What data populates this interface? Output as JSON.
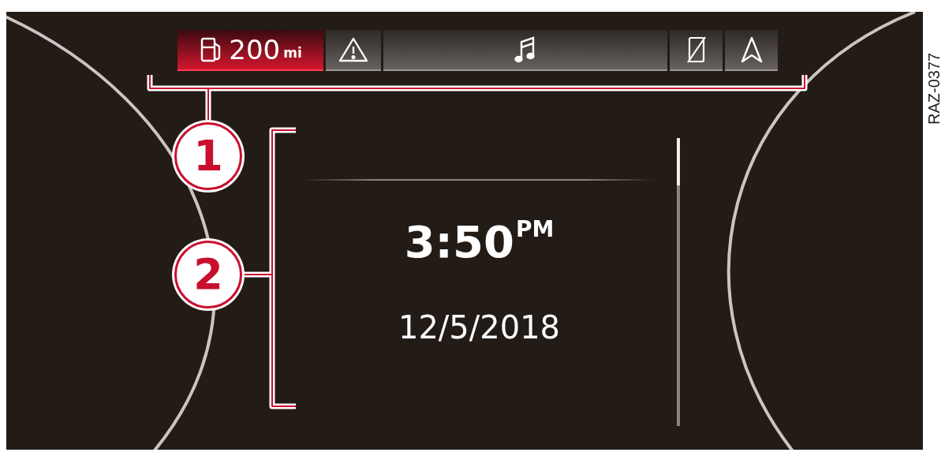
{
  "status_bar": {
    "tabs": [
      {
        "kind": "fuel",
        "text": "200",
        "unit": "mi",
        "selected": true
      },
      {
        "kind": "warning",
        "selected": false
      },
      {
        "kind": "media",
        "selected": false
      },
      {
        "kind": "phone",
        "selected": false
      },
      {
        "kind": "navigation",
        "selected": false
      }
    ]
  },
  "clock": {
    "time": "3:50",
    "period": "PM",
    "date": "12/5/2018"
  },
  "callouts": [
    {
      "number": "1"
    },
    {
      "number": "2"
    }
  ],
  "figure_code": "RAZ-0377"
}
